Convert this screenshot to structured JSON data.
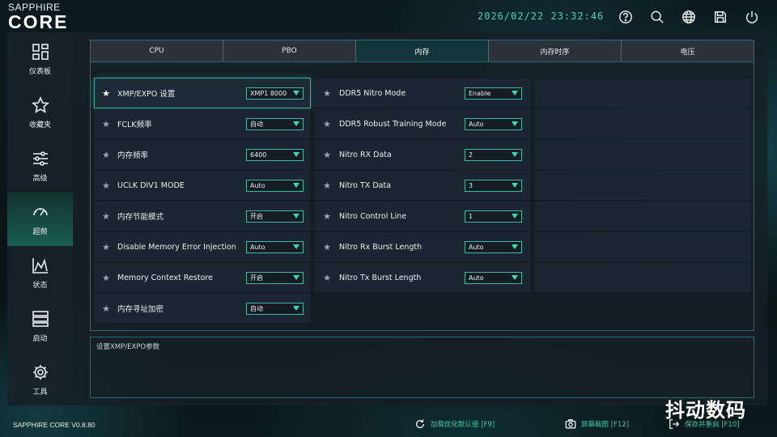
{
  "app": {
    "brand_top": "SAPPHIRE",
    "brand_main": "CORE",
    "datetime": "2026/02/22 23:32:46",
    "version": "SAPPHIRE CORE V0.8.80"
  },
  "header_icons": [
    "help-icon",
    "search-icon",
    "globe-icon",
    "save-icon",
    "power-icon"
  ],
  "sidebar": {
    "items": [
      {
        "label": "仪表板",
        "icon": "dashboard-icon"
      },
      {
        "label": "收藏夹",
        "icon": "star-icon"
      },
      {
        "label": "高级",
        "icon": "sliders-icon"
      },
      {
        "label": "超频",
        "icon": "gauge-icon",
        "active": true
      },
      {
        "label": "状态",
        "icon": "chart-icon"
      },
      {
        "label": "启动",
        "icon": "server-icon"
      },
      {
        "label": "工具",
        "icon": "gear-icon"
      }
    ]
  },
  "tabs": [
    {
      "label": "CPU"
    },
    {
      "label": "PBO"
    },
    {
      "label": "内存",
      "active": true
    },
    {
      "label": "内存时序"
    },
    {
      "label": "电压"
    }
  ],
  "settings": {
    "col1": [
      {
        "label": "XMP/EXPO 设置",
        "value": "XMP1 8000"
      },
      {
        "label": "FCLK频率",
        "value": "自动"
      },
      {
        "label": "内存频率",
        "value": "6400"
      },
      {
        "label": "UCLK DIV1 MODE",
        "value": "Auto"
      },
      {
        "label": "内存节能模式",
        "value": "开启"
      },
      {
        "label": "Disable Memory Error Injection",
        "value": "Auto"
      },
      {
        "label": "Memory Context Restore",
        "value": "开启"
      },
      {
        "label": "内存寻址加密",
        "value": "自动"
      }
    ],
    "col2": [
      {
        "label": "DDR5 Nitro Mode",
        "value": "Enable"
      },
      {
        "label": "DDR5 Robust Training Mode",
        "value": "Auto"
      },
      {
        "label": "Nitro RX Data",
        "value": "2"
      },
      {
        "label": "Nitro TX Data",
        "value": "3"
      },
      {
        "label": "Nitro Control Line",
        "value": "1"
      },
      {
        "label": "Nitro Rx Burst Length",
        "value": "Auto"
      },
      {
        "label": "Nitro Tx Burst Length",
        "value": "Auto"
      }
    ]
  },
  "description": "设置XMP/EXPO参数",
  "footer": {
    "load_defaults": "加载优化默认值 [F9]",
    "screenshot": "屏幕截图 [F12]",
    "save_restart": "保存并重启 [F10]"
  },
  "watermark": "抖动数码",
  "colors": {
    "accent": "#3fd6b6",
    "datetime": "#46d3b0",
    "footer_text": "#35c8a6",
    "panel": "#1c2633",
    "border": "#2e6a72"
  }
}
